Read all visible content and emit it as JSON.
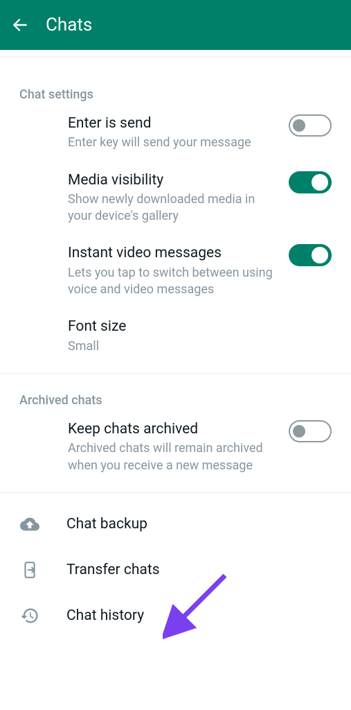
{
  "header": {
    "title": "Chats"
  },
  "sections": {
    "chat_settings": {
      "header": "Chat settings",
      "enter_is_send": {
        "title": "Enter is send",
        "subtitle": "Enter key will send your message",
        "enabled": false
      },
      "media_visibility": {
        "title": "Media visibility",
        "subtitle": "Show newly downloaded media in your device's gallery",
        "enabled": true
      },
      "instant_video": {
        "title": "Instant video messages",
        "subtitle": "Lets you tap to switch between using voice and video messages",
        "enabled": true
      },
      "font_size": {
        "title": "Font size",
        "value": "Small"
      }
    },
    "archived": {
      "header": "Archived chats",
      "keep_archived": {
        "title": "Keep chats archived",
        "subtitle": "Archived chats will remain archived when you receive a new message",
        "enabled": false
      }
    },
    "actions": {
      "chat_backup": "Chat backup",
      "transfer_chats": "Transfer chats",
      "chat_history": "Chat history"
    }
  }
}
